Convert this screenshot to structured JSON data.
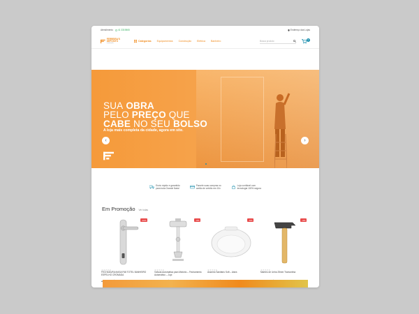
{
  "topbar": {
    "label": "Atendimento",
    "phone": "41 3319865",
    "store_link": "Endereço das Lojas"
  },
  "nav": {
    "logo_name": "FERREIRA'S DEPÓSITO",
    "logo_tagline": "construção",
    "categories_label": "Categorias",
    "menu": [
      "Equipamentos",
      "Construção",
      "Elétrica",
      "Banheiro"
    ],
    "search_placeholder": "Busca produto",
    "cart_count": "0"
  },
  "hero": {
    "title_line1_thin": "SUA",
    "title_line1_bold": "OBRA",
    "title_line2_thin": "PELO",
    "title_line2_bold": "PREÇO",
    "title_line2_thin2": "QUE",
    "title_line3_bold": "CABE",
    "title_line3_thin": "NO SEU",
    "title_line3_bold2": "BOLSO",
    "subtitle": "A loja mais completa da cidade, agora em site.",
    "prev": "‹",
    "next": "›"
  },
  "features": [
    {
      "icon": "truck-icon",
      "line1": "Envio rápido e garantido",
      "line2": "para toda Grande Natal"
    },
    {
      "icon": "card-icon",
      "line1": "Parcele suas compras no",
      "line2": "cartão de crédito em 10x"
    },
    {
      "icon": "lock-icon",
      "line1": "Loja confiável com",
      "line2": "tecnologia 100% segura"
    }
  ],
  "promo": {
    "title": "Em Promoção",
    "view_all": "Ver todas"
  },
  "products": [
    {
      "name": "FECHADURA MASA F68 TOTEL BANHEIRO ESPELHO CROMADA",
      "discount": "-11%",
      "old": "R$ 49,00",
      "new": "R$ 43,90",
      "stars": "★★★★★"
    },
    {
      "name": "Válvula Automática para Mictório – Fechamento Automático – Jupi",
      "discount": "-3%",
      "old": "R$ 321,00",
      "new": "R$ 312,90",
      "stars": "★★★★★"
    },
    {
      "name": "Assento Sanitário Soft – Astra",
      "discount": "-5%",
      "old": "R$ 44,00",
      "new": "R$ 41,90",
      "stars": "★★★★★"
    },
    {
      "name": "Martelo de Unha 25mm Tramontina",
      "discount": "-4%",
      "old": "R$ 35,00",
      "new": "R$ 33,90",
      "stars": "★★★★★"
    }
  ],
  "colors": {
    "brand_orange": "#f08a1c",
    "accent_teal": "#1d8fae",
    "sale_red": "#e84949",
    "phone_green": "#35b060"
  }
}
